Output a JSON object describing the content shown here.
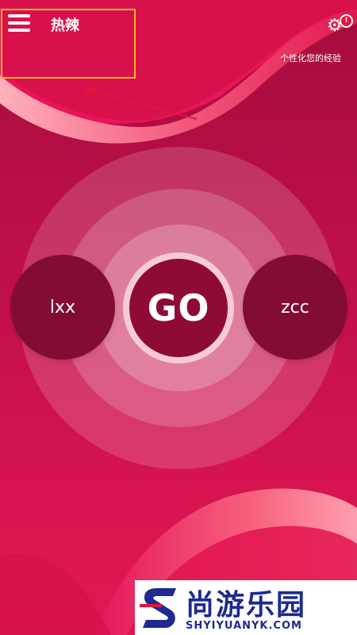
{
  "header": {
    "title": "热辣",
    "settings_caption": "个性化您的经验",
    "alert_badge": "!"
  },
  "main": {
    "left_player": "lxx",
    "right_player": "zcc",
    "go_label": "GO"
  },
  "watermark": {
    "brand": "尚游乐园",
    "url": "SHYIYUANYK.COM"
  },
  "colors": {
    "background": "#c0104a",
    "circle_dark": "#820c32",
    "highlight_box": "#f7b81a",
    "arrow": "#e5143f",
    "watermark_text": "#1d2a8f"
  },
  "icons": {
    "menu": "hamburger-menu-icon",
    "settings": "gear-icon",
    "alert": "alert-badge-icon",
    "arrow": "annotation-arrow-icon"
  }
}
